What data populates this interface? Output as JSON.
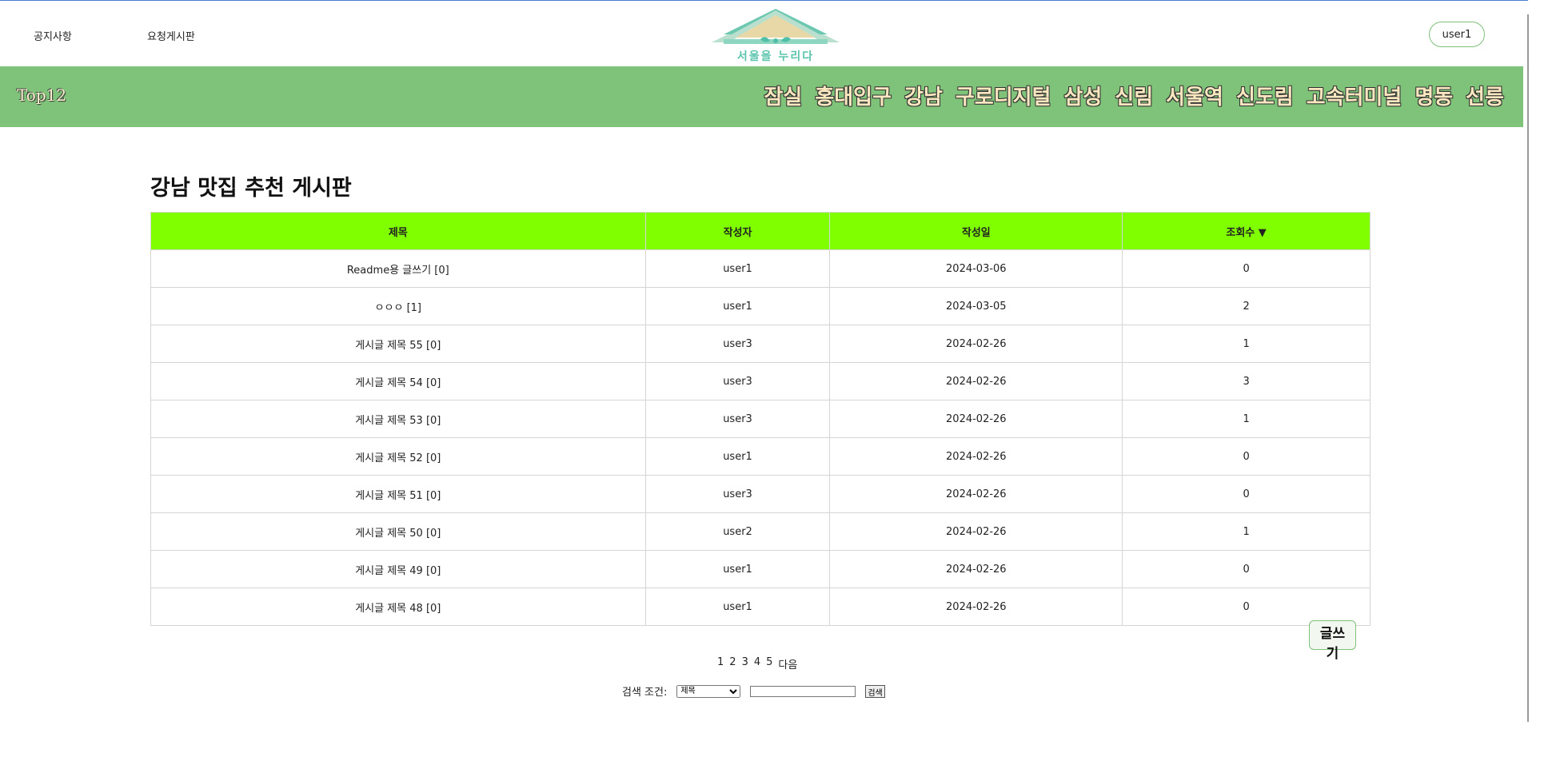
{
  "header": {
    "nav": [
      "공지사항",
      "요청게시판"
    ],
    "logo_text": "서울을 누리다",
    "user_button": "user1"
  },
  "bar": {
    "title": "Top12",
    "regions": [
      "잠실",
      "홍대입구",
      "강남",
      "구로디지털",
      "삼성",
      "신림",
      "서울역",
      "신도림",
      "고속터미널",
      "명동",
      "선릉"
    ]
  },
  "board": {
    "title": "강남 맛집 추천 게시판",
    "columns": [
      "제목",
      "작성자",
      "작성일",
      "조회수 ▼"
    ],
    "rows": [
      [
        "Readme용 글쓰기 [0]",
        "user1",
        "2024-03-06",
        "0"
      ],
      [
        "ㅇㅇㅇ [1]",
        "user1",
        "2024-03-05",
        "2"
      ],
      [
        "게시글 제목 55 [0]",
        "user3",
        "2024-02-26",
        "1"
      ],
      [
        "게시글 제목 54 [0]",
        "user3",
        "2024-02-26",
        "3"
      ],
      [
        "게시글 제목 53 [0]",
        "user3",
        "2024-02-26",
        "1"
      ],
      [
        "게시글 제목 52 [0]",
        "user1",
        "2024-02-26",
        "0"
      ],
      [
        "게시글 제목 51 [0]",
        "user3",
        "2024-02-26",
        "0"
      ],
      [
        "게시글 제목 50 [0]",
        "user2",
        "2024-02-26",
        "1"
      ],
      [
        "게시글 제목 49 [0]",
        "user1",
        "2024-02-26",
        "0"
      ],
      [
        "게시글 제목 48 [0]",
        "user1",
        "2024-02-26",
        "0"
      ]
    ],
    "write_button": "글쓰기"
  },
  "pager": {
    "pages": [
      "1",
      "2",
      "3",
      "4",
      "5"
    ],
    "next": "다음"
  },
  "search": {
    "label": "검색 조건:",
    "selected_option": "제목",
    "input_value": "",
    "button": "검색"
  },
  "colors": {
    "bar_green": "#7fc27a",
    "header_row": "#7fff00"
  }
}
